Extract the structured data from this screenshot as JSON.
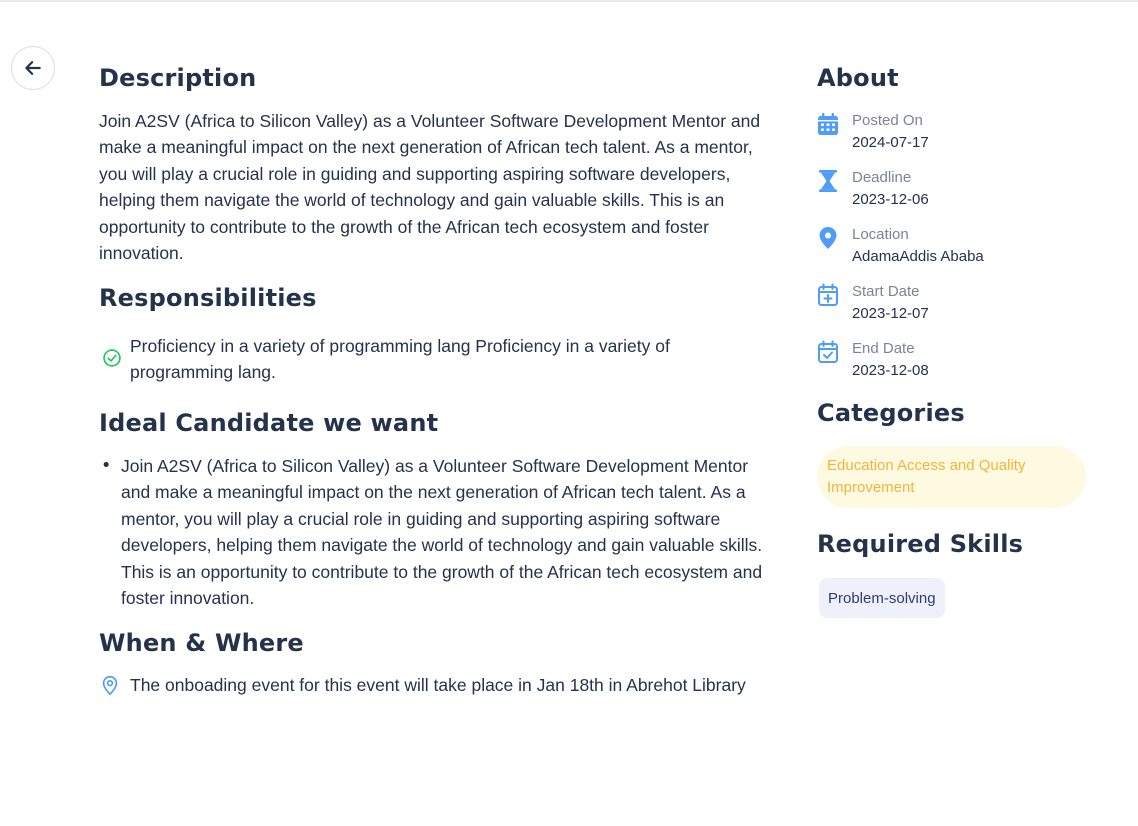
{
  "back": {
    "icon": "arrow-left-icon"
  },
  "description": {
    "title": "Description",
    "text": "Join A2SV (Africa to Silicon Valley) as a Volunteer Software Development Mentor and make a meaningful impact on the next generation of African tech talent. As a mentor, you will play a crucial role in guiding and supporting aspiring software developers, helping them navigate the world of technology and gain valuable skills. This is an opportunity to contribute to the growth of the African tech ecosystem and foster innovation."
  },
  "responsibilities": {
    "title": "Responsibilities",
    "items": [
      {
        "icon": "check-circle-icon",
        "text": "Proficiency in a variety of programming lang Proficiency in a variety of programming lang."
      }
    ]
  },
  "ideal": {
    "title": "Ideal Candidate we want",
    "items": [
      "Join A2SV (Africa to Silicon Valley) as a Volunteer Software Development Mentor and make a meaningful impact on the next generation of African tech talent. As a mentor, you will play a crucial role in guiding and supporting aspiring software developers, helping them navigate the world of technology and gain valuable skills. This is an opportunity to contribute to the growth of the African tech ecosystem and foster innovation."
    ]
  },
  "when_where": {
    "title": "When & Where",
    "icon": "map-pin-icon",
    "text": "The onboading event for this event will take place in Jan 18th in Abrehot Library"
  },
  "about": {
    "title": "About",
    "items": [
      {
        "icon": "calendar-icon",
        "label": "Posted On",
        "value": "2024-07-17"
      },
      {
        "icon": "hourglass-icon",
        "label": "Deadline",
        "value": "2023-12-06"
      },
      {
        "icon": "location-pin-icon",
        "label": "Location",
        "value": "AdamaAddis Ababa"
      },
      {
        "icon": "calendar-plus-icon",
        "label": "Start Date",
        "value": "2023-12-07"
      },
      {
        "icon": "calendar-check-icon",
        "label": "End Date",
        "value": "2023-12-08"
      }
    ]
  },
  "categories": {
    "title": "Categories",
    "items": [
      "Education Access and Quality Improvement"
    ]
  },
  "skills": {
    "title": "Required Skills",
    "items": [
      "Problem-solving"
    ]
  },
  "colors": {
    "heading": "#25324b",
    "accent_blue": "#4f9cf9",
    "check_green": "#56cdad",
    "category_bg": "#fef9e1",
    "category_text": "#f2b53c",
    "skill_bg": "#eef0fa",
    "skill_text": "#2f3b7a"
  }
}
